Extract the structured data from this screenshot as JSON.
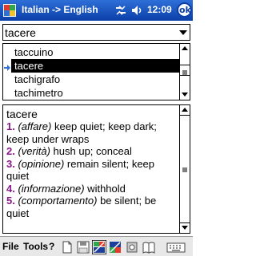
{
  "titlebar": {
    "title": "Italian -> English",
    "time": "12:09",
    "ok_label": "ok",
    "icons": [
      "app-logo-icon",
      "connectivity-icon",
      "volume-icon"
    ]
  },
  "search": {
    "value": "tacere"
  },
  "word_list": {
    "items": [
      "taccuino",
      "tacere",
      "tachigrafo",
      "tachimetro"
    ],
    "selected": "tacere"
  },
  "definition": {
    "headword": "tacere",
    "senses": [
      {
        "num": "1.",
        "context": "(affare)",
        "text": " keep quiet; keep dark; keep under wraps"
      },
      {
        "num": "2.",
        "context": "(verità)",
        "text": " hush up; conceal"
      },
      {
        "num": "3.",
        "context": "(opinione)",
        "text": " remain silent; keep quiet"
      },
      {
        "num": "4.",
        "context": "(informazione)",
        "text": " withhold"
      },
      {
        "num": "5.",
        "context": "(comportamento)",
        "text": " be silent; be quiet"
      }
    ]
  },
  "toolbar": {
    "file_label": "File",
    "tools_label": "Tools",
    "help_label": "?",
    "icons": [
      "new-document-icon",
      "save-icon",
      "translate-it-en-icon",
      "translate-en-it-icon",
      "settings-icon",
      "book-icon",
      "keyboard-icon"
    ]
  },
  "colors": {
    "titlebar": "#0b3fa8",
    "sense_number": "#8a1a8a",
    "selection": "#000000"
  }
}
